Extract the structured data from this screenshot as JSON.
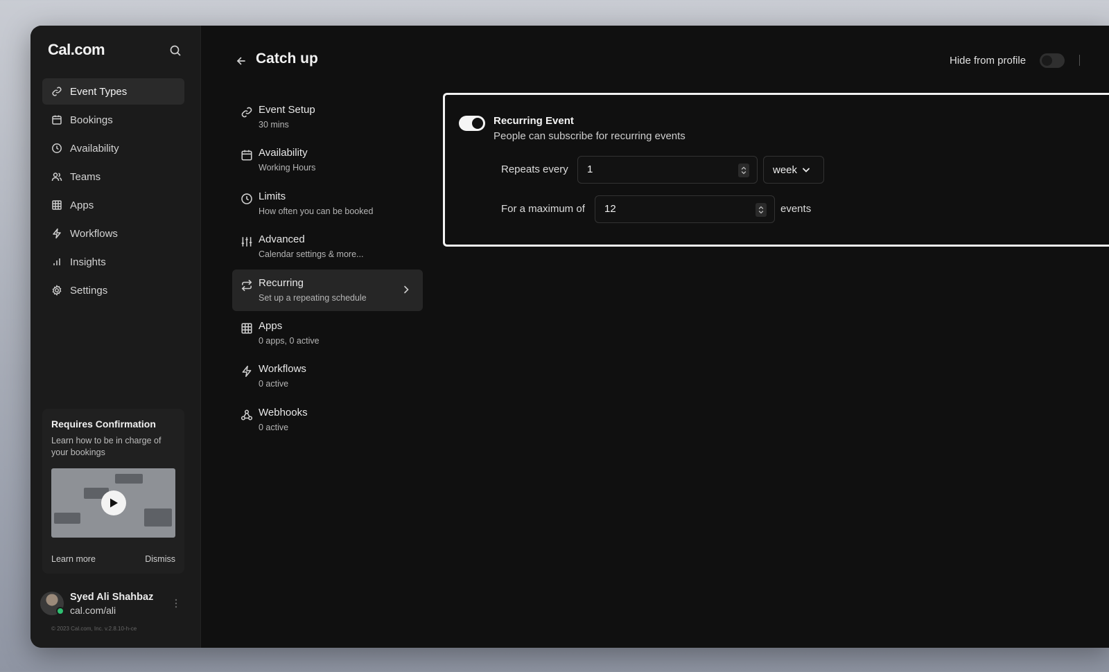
{
  "app": {
    "logo": "Cal.com"
  },
  "sidebar": {
    "items": [
      {
        "label": "Event Types",
        "icon": "link-icon",
        "active": true
      },
      {
        "label": "Bookings",
        "icon": "calendar-icon"
      },
      {
        "label": "Availability",
        "icon": "clock-icon"
      },
      {
        "label": "Teams",
        "icon": "users-icon"
      },
      {
        "label": "Apps",
        "icon": "grid-icon"
      },
      {
        "label": "Workflows",
        "icon": "zap-icon"
      },
      {
        "label": "Insights",
        "icon": "bar-chart-icon"
      },
      {
        "label": "Settings",
        "icon": "gear-icon"
      }
    ],
    "promo": {
      "title": "Requires Confirmation",
      "description": "Learn how to be in charge of your bookings",
      "learn_more": "Learn more",
      "dismiss": "Dismiss"
    },
    "user": {
      "name": "Syed Ali Shahbaz",
      "url": "cal.com/ali"
    },
    "copyright": "© 2023 Cal.com, Inc. v.2.8.10-h-ce"
  },
  "header": {
    "title": "Catch up",
    "hide_from_profile_label": "Hide from profile",
    "hide_from_profile_enabled": false
  },
  "subnav": {
    "items": [
      {
        "label": "Event Setup",
        "desc": "30 mins",
        "icon": "link-icon"
      },
      {
        "label": "Availability",
        "desc": "Working Hours",
        "icon": "calendar-icon"
      },
      {
        "label": "Limits",
        "desc": "How often you can be booked",
        "icon": "clock-icon"
      },
      {
        "label": "Advanced",
        "desc": "Calendar settings & more...",
        "icon": "sliders-icon"
      },
      {
        "label": "Recurring",
        "desc": "Set up a repeating schedule",
        "icon": "repeat-icon",
        "active": true
      },
      {
        "label": "Apps",
        "desc": "0 apps, 0 active",
        "icon": "grid-icon"
      },
      {
        "label": "Workflows",
        "desc": "0 active",
        "icon": "zap-icon"
      },
      {
        "label": "Webhooks",
        "desc": "0 active",
        "icon": "webhook-icon"
      }
    ]
  },
  "recurring": {
    "toggle_enabled": true,
    "title": "Recurring Event",
    "description": "People can subscribe for recurring events",
    "repeats_every_label": "Repeats every",
    "repeats_every_value": "1",
    "frequency_value": "week",
    "maximum_label": "For a maximum of",
    "maximum_value": "12",
    "events_label": "events"
  },
  "colors": {
    "background": "#101010",
    "sidebar": "#1b1b1b",
    "active_item": "#2a2a2a",
    "online": "#2fbf71"
  }
}
